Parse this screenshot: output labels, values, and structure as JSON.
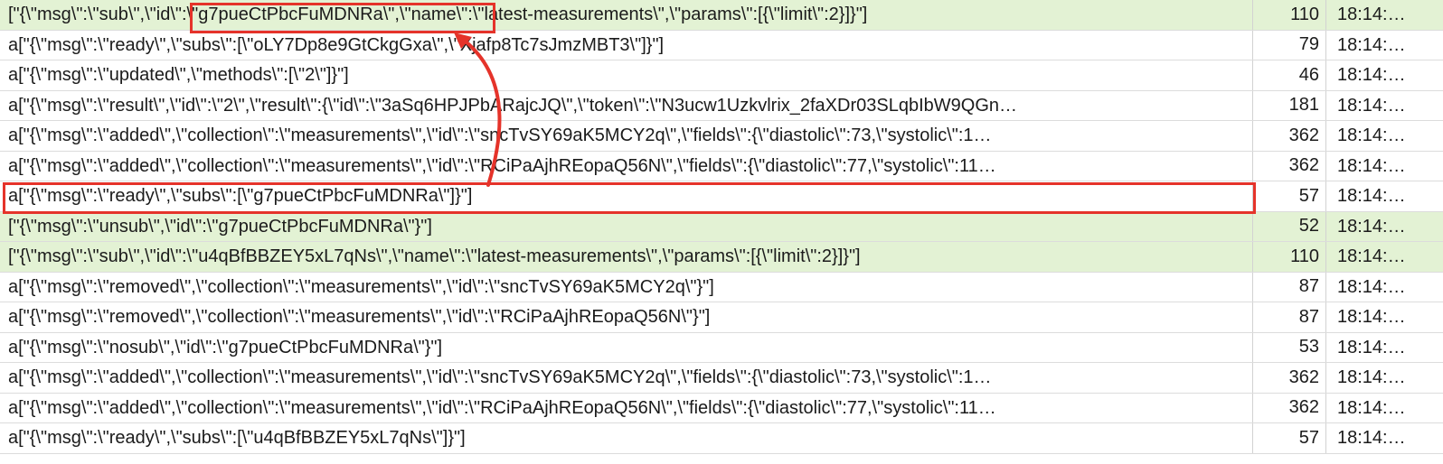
{
  "frames": [
    {
      "message": "[\"{\\\"msg\\\":\\\"sub\\\",\\\"id\\\":\\\"g7pueCtPbcFuMDNRa\\\",\\\"name\\\":\\\"latest-measurements\\\",\\\"params\\\":[{\\\"limit\\\":2}]}\"]",
      "length": "110",
      "time": "18:14:…",
      "direction": "sent"
    },
    {
      "message": "a[\"{\\\"msg\\\":\\\"ready\\\",\\\"subs\\\":[\\\"oLY7Dp8e9GtCkgGxa\\\",\\\"Xjafp8Tc7sJmzMBT3\\\"]}\"]",
      "length": "79",
      "time": "18:14:…",
      "direction": "received"
    },
    {
      "message": "a[\"{\\\"msg\\\":\\\"updated\\\",\\\"methods\\\":[\\\"2\\\"]}\"]",
      "length": "46",
      "time": "18:14:…",
      "direction": "received"
    },
    {
      "message": "a[\"{\\\"msg\\\":\\\"result\\\",\\\"id\\\":\\\"2\\\",\\\"result\\\":{\\\"id\\\":\\\"3aSq6HPJPbARajcJQ\\\",\\\"token\\\":\\\"N3ucw1Uzkvlrix_2faXDr03SLqbIbW9QGn…",
      "length": "181",
      "time": "18:14:…",
      "direction": "received"
    },
    {
      "message": "a[\"{\\\"msg\\\":\\\"added\\\",\\\"collection\\\":\\\"measurements\\\",\\\"id\\\":\\\"sncTvSY69aK5MCY2q\\\",\\\"fields\\\":{\\\"diastolic\\\":73,\\\"systolic\\\":1…",
      "length": "362",
      "time": "18:14:…",
      "direction": "received"
    },
    {
      "message": "a[\"{\\\"msg\\\":\\\"added\\\",\\\"collection\\\":\\\"measurements\\\",\\\"id\\\":\\\"RCiPaAjhREopaQ56N\\\",\\\"fields\\\":{\\\"diastolic\\\":77,\\\"systolic\\\":11…",
      "length": "362",
      "time": "18:14:…",
      "direction": "received"
    },
    {
      "message": "a[\"{\\\"msg\\\":\\\"ready\\\",\\\"subs\\\":[\\\"g7pueCtPbcFuMDNRa\\\"]}\"]",
      "length": "57",
      "time": "18:14:…",
      "direction": "received"
    },
    {
      "message": "[\"{\\\"msg\\\":\\\"unsub\\\",\\\"id\\\":\\\"g7pueCtPbcFuMDNRa\\\"}\"]",
      "length": "52",
      "time": "18:14:…",
      "direction": "sent"
    },
    {
      "message": "[\"{\\\"msg\\\":\\\"sub\\\",\\\"id\\\":\\\"u4qBfBBZEY5xL7qNs\\\",\\\"name\\\":\\\"latest-measurements\\\",\\\"params\\\":[{\\\"limit\\\":2}]}\"]",
      "length": "110",
      "time": "18:14:…",
      "direction": "sent"
    },
    {
      "message": "a[\"{\\\"msg\\\":\\\"removed\\\",\\\"collection\\\":\\\"measurements\\\",\\\"id\\\":\\\"sncTvSY69aK5MCY2q\\\"}\"]",
      "length": "87",
      "time": "18:14:…",
      "direction": "received"
    },
    {
      "message": "a[\"{\\\"msg\\\":\\\"removed\\\",\\\"collection\\\":\\\"measurements\\\",\\\"id\\\":\\\"RCiPaAjhREopaQ56N\\\"}\"]",
      "length": "87",
      "time": "18:14:…",
      "direction": "received"
    },
    {
      "message": "a[\"{\\\"msg\\\":\\\"nosub\\\",\\\"id\\\":\\\"g7pueCtPbcFuMDNRa\\\"}\"]",
      "length": "53",
      "time": "18:14:…",
      "direction": "received"
    },
    {
      "message": "a[\"{\\\"msg\\\":\\\"added\\\",\\\"collection\\\":\\\"measurements\\\",\\\"id\\\":\\\"sncTvSY69aK5MCY2q\\\",\\\"fields\\\":{\\\"diastolic\\\":73,\\\"systolic\\\":1…",
      "length": "362",
      "time": "18:14:…",
      "direction": "received"
    },
    {
      "message": "a[\"{\\\"msg\\\":\\\"added\\\",\\\"collection\\\":\\\"measurements\\\",\\\"id\\\":\\\"RCiPaAjhREopaQ56N\\\",\\\"fields\\\":{\\\"diastolic\\\":77,\\\"systolic\\\":11…",
      "length": "362",
      "time": "18:14:…",
      "direction": "received"
    },
    {
      "message": "a[\"{\\\"msg\\\":\\\"ready\\\",\\\"subs\\\":[\\\"u4qBfBBZEY5xL7qNs\\\"]}\"]",
      "length": "57",
      "time": "18:14:…",
      "direction": "received"
    }
  ],
  "colors": {
    "sent_row": "#e3f2d4",
    "highlight": "#e5332a"
  }
}
